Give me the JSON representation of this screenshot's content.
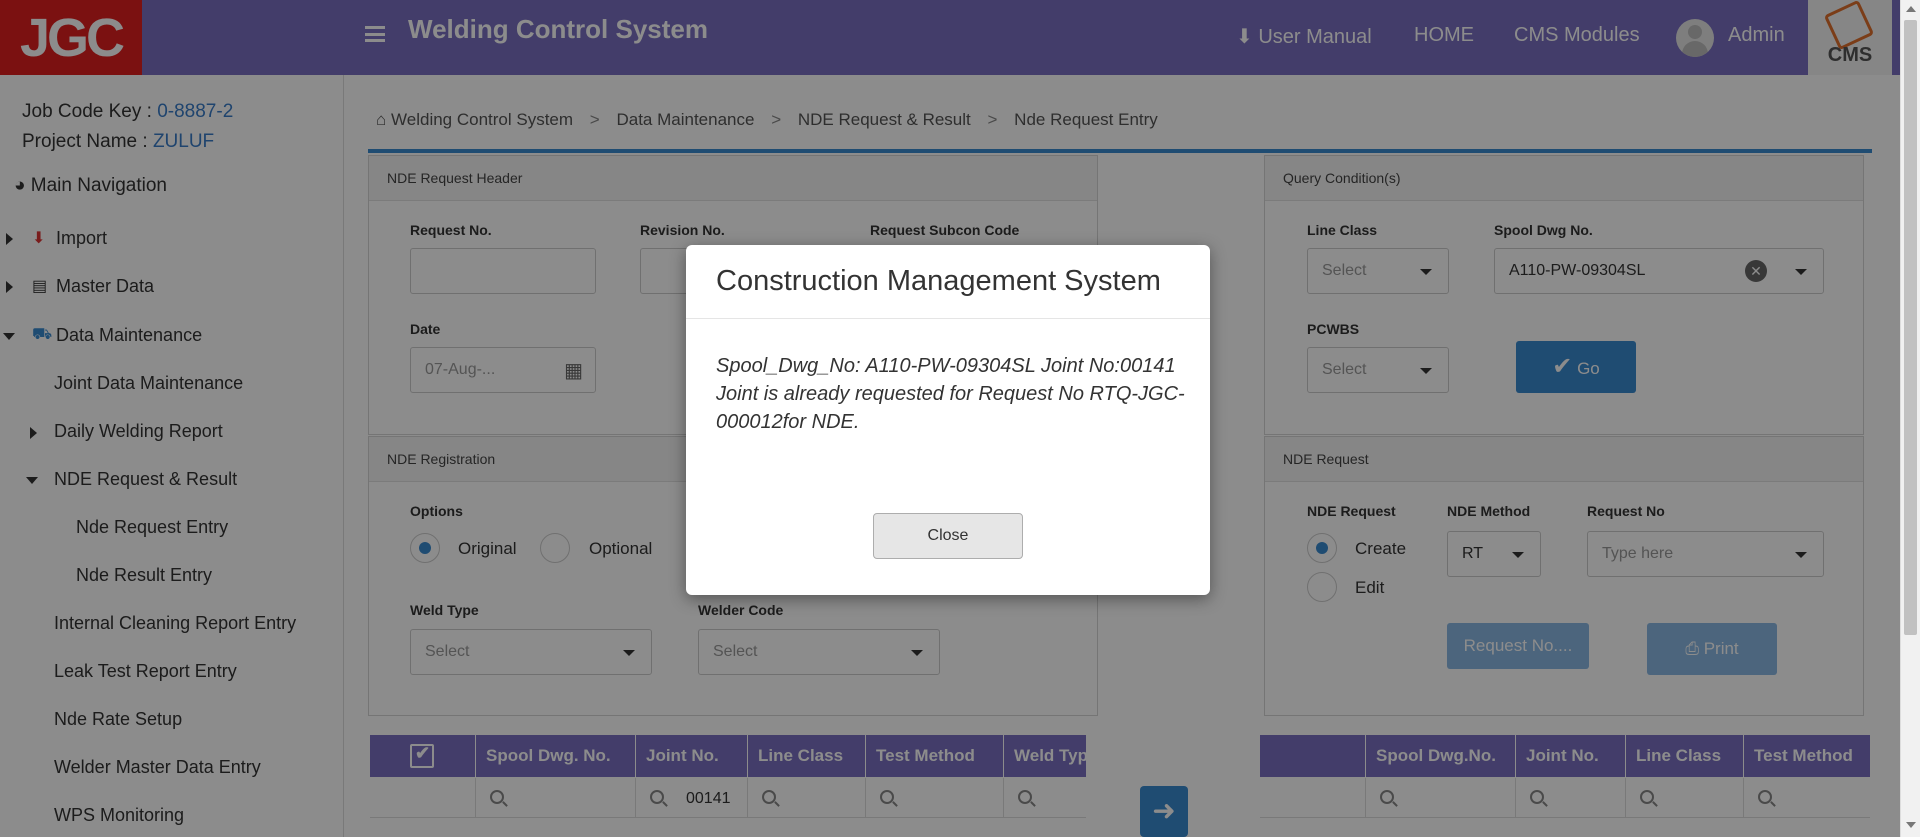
{
  "header": {
    "logo": "JGC",
    "title": "Welding Control System",
    "nav": {
      "user_manual": "User Manual",
      "home": "HOME",
      "cms_modules": "CMS Modules",
      "admin": "Admin"
    },
    "cms_logo": "CMS"
  },
  "sidebar": {
    "job_code_label": "Job Code Key :",
    "job_code_value": "0-8887-2",
    "project_label": "Project Name :",
    "project_value": "ZULUF",
    "main_nav": "Main Navigation",
    "items": [
      {
        "label": "Import"
      },
      {
        "label": "Master Data"
      },
      {
        "label": "Data Maintenance"
      },
      {
        "label": "Joint Data Maintenance"
      },
      {
        "label": "Daily Welding Report"
      },
      {
        "label": "NDE Request & Result"
      },
      {
        "label": "Nde Request Entry"
      },
      {
        "label": "Nde Result Entry"
      },
      {
        "label": "Internal Cleaning Report Entry"
      },
      {
        "label": "Leak Test Report Entry"
      },
      {
        "label": "Nde Rate Setup"
      },
      {
        "label": "Welder Master Data Entry"
      },
      {
        "label": "WPS Monitoring"
      }
    ]
  },
  "breadcrumb": [
    "Welding Control System",
    "Data Maintenance",
    "NDE Request & Result",
    "Nde Request Entry"
  ],
  "request_header": {
    "title": "NDE Request Header",
    "request_no_label": "Request No.",
    "revision_no_label": "Revision No.",
    "subcon_label": "Request Subcon Code",
    "date_label": "Date",
    "date_value": "07-Aug-..."
  },
  "query": {
    "title": "Query Condition(s)",
    "line_class_label": "Line Class",
    "line_class_value": "Select",
    "spool_label": "Spool Dwg No.",
    "spool_value": "A110-PW-09304SL",
    "pcwbs_label": "PCWBS",
    "pcwbs_value": "Select",
    "go_label": "Go"
  },
  "registration": {
    "title": "NDE Registration",
    "options_label": "Options",
    "original": "Original",
    "optional": "Optional",
    "weld_type_label": "Weld Type",
    "weld_type_value": "Select",
    "welder_code_label": "Welder Code",
    "welder_code_value": "Select"
  },
  "nde_request": {
    "title": "NDE Request",
    "request_label": "NDE Request",
    "create": "Create",
    "edit": "Edit",
    "method_label": "NDE Method",
    "method_value": "RT",
    "request_no_label": "Request No",
    "request_no_placeholder": "Type here",
    "request_no_btn": "Request No....",
    "print_btn": "Print"
  },
  "left_grid": {
    "columns": [
      "Spool Dwg. No.",
      "Joint No.",
      "Line Class",
      "Test Method",
      "Weld Typ"
    ],
    "joint_filter": "00141"
  },
  "right_grid": {
    "columns": [
      "Spool Dwg.No.",
      "Joint No.",
      "Line Class",
      "Test Method"
    ]
  },
  "modal": {
    "title": "Construction Management System",
    "message": "Spool_Dwg_No: A110-PW-09304SL Joint No:00141 Joint is already requested for Request No RTQ-JGC-000012for NDE.",
    "close": "Close"
  }
}
